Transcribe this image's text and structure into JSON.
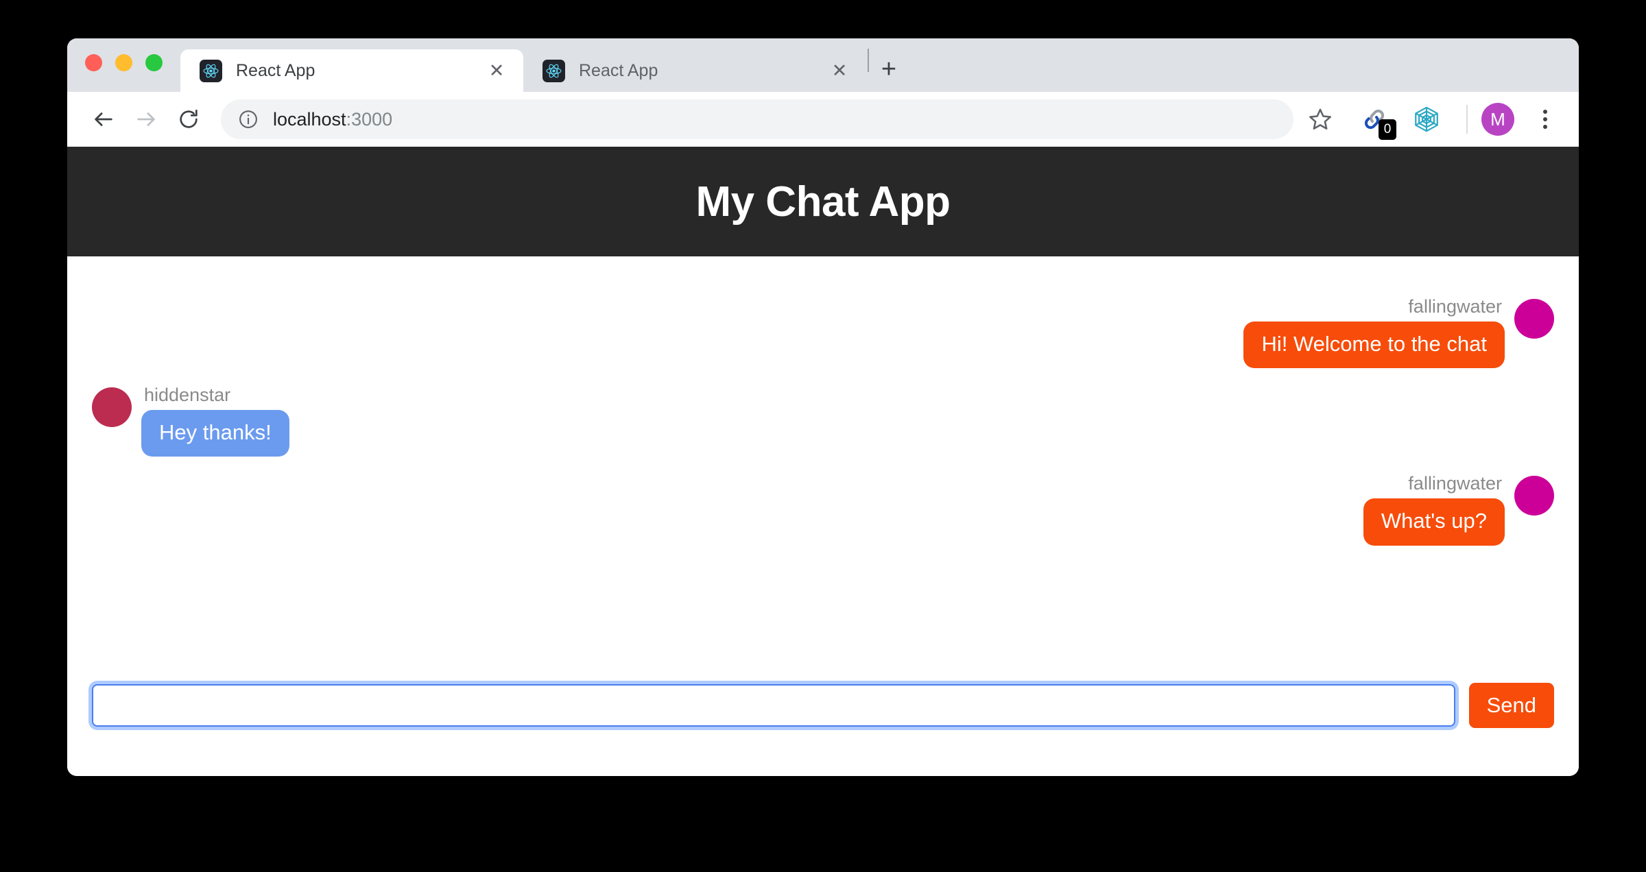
{
  "window": {
    "traffic_lights": [
      {
        "name": "close",
        "color": "#ff5f57"
      },
      {
        "name": "minimize",
        "color": "#febc2e"
      },
      {
        "name": "maximize",
        "color": "#28c840"
      }
    ]
  },
  "browser": {
    "tabs": [
      {
        "title": "React App",
        "favicon": "react-logo-icon",
        "active": true,
        "close_label": "✕"
      },
      {
        "title": "React App",
        "favicon": "react-logo-icon",
        "active": false,
        "close_label": "✕"
      }
    ],
    "new_tab_label": "+",
    "toolbar": {
      "back_label": "←",
      "forward_label": "→",
      "reload_label": "⟳",
      "info_icon": "site-info-icon",
      "url_host": "localhost",
      "url_port": ":3000",
      "star_icon": "bookmark-star-icon",
      "extensions": [
        {
          "icon": "chain-link-extension-icon",
          "badge": "0"
        },
        {
          "icon": "hexagon-extension-icon",
          "badge": ""
        }
      ],
      "profile_initial": "M",
      "profile_color": "#b844c4",
      "menu_icon": "three-dot-menu-icon"
    }
  },
  "app": {
    "title": "My Chat App",
    "header_bg": "#282828",
    "messages": [
      {
        "user": "fallingwater",
        "text": "Hi! Welcome to the chat",
        "side": "right",
        "bubble_color": "#f74c0a",
        "avatar_color": "#cc0099"
      },
      {
        "user": "hiddenstar",
        "text": "Hey thanks!",
        "side": "left",
        "bubble_color": "#6b9bef",
        "avatar_color": "#bc2b50"
      },
      {
        "user": "fallingwater",
        "text": "What's up?",
        "side": "right",
        "bubble_color": "#f74c0a",
        "avatar_color": "#cc0099"
      }
    ],
    "composer": {
      "input_value": "",
      "input_placeholder": "",
      "send_label": "Send",
      "send_color": "#f74c0a",
      "focus_ring_color": "#4a7cf0"
    }
  }
}
